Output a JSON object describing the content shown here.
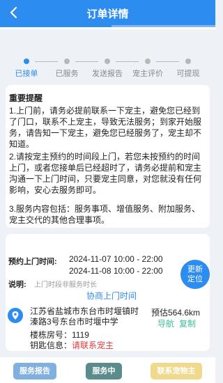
{
  "header": {
    "title": "订单详情"
  },
  "steps": [
    {
      "label": "已接单"
    },
    {
      "label": "已服务"
    },
    {
      "label": "发送报告"
    },
    {
      "label": "宠主评价"
    },
    {
      "label": "可提现"
    }
  ],
  "notice": {
    "title": "重要提醒",
    "p1": "1.上门前，请务必提前联系一下宠主，避免您已经到了门口，联系不上宠主，导致无法服务；到家开始服务，请告知一下宠主，避免您已经服务了，宠主却不知道。",
    "p2": "2.请按宠主预约的时间段上门，若您未按预约的时间上门，或者您接单后已经超时了，请务必提前和宠主沟通一下上门时间，只要宠主同意，对您就没有任何影响，安心去服务即可。",
    "p3": "3.服务内容包括：服务事项、增值服务、附加服务、宠主交代的其他合理事项。"
  },
  "detail": {
    "visit_label": "预约上门时间:",
    "time1": "2024-11-07 10:00 - 22:00",
    "time2": "2024-11-08 10:00 - 22:00",
    "note_label": "说明:",
    "note_text": "上门时段非服务时长",
    "negotiate": "协商上门时间",
    "relocate_line1": "更新",
    "relocate_line2": "定位",
    "address": "江苏省盐城市东台市时堰镇时溱路3号东台市时堰中学",
    "room_label": "楼栋房号：",
    "room_value": "1119",
    "key_label": "钥匙信息：",
    "key_value": "请联系宠主",
    "distance": "预估564.6km",
    "navigate": "导航",
    "copy": "复制"
  },
  "footer": {
    "report": "服务报告",
    "in_service": "服务中",
    "contact": "联系宠物主"
  },
  "colors": {
    "brand": "#2d8cf0",
    "report_btn": "#7fb0e0",
    "in_service_btn": "#5b8c8c",
    "contact_btn": "#f0d98c"
  }
}
